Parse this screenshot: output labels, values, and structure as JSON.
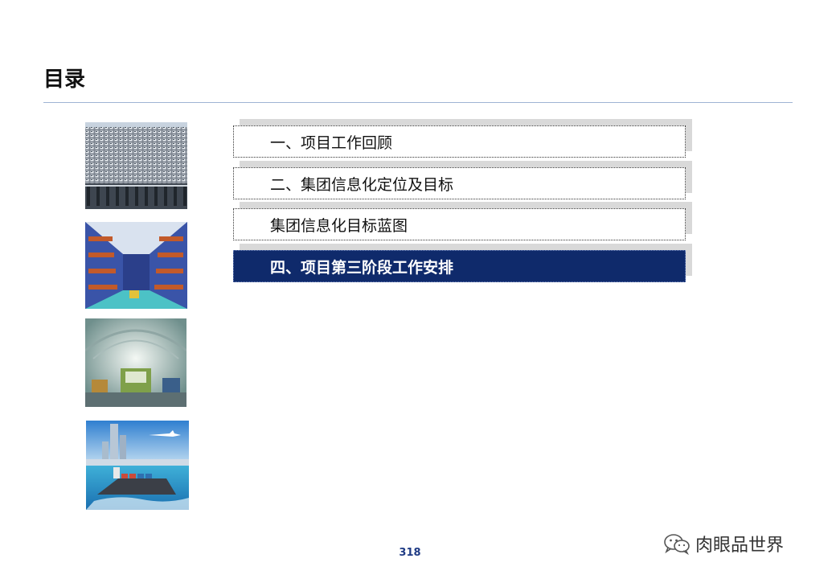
{
  "slide": {
    "title": "目录",
    "page_number": "318"
  },
  "menu": {
    "items": [
      {
        "label": "一、项目工作回顾",
        "active": false
      },
      {
        "label": "二、集团信息化定位及目标",
        "active": false
      },
      {
        "label": "集团信息化目标蓝图",
        "active": false
      },
      {
        "label": "四、项目第三阶段工作安排",
        "active": true
      }
    ]
  },
  "thumbnails": [
    {
      "subject": "car-parking-lot-photo"
    },
    {
      "subject": "warehouse-shelves-photo"
    },
    {
      "subject": "factory-hall-photo"
    },
    {
      "subject": "port-ship-airplane-photo"
    }
  ],
  "watermark": {
    "text": "肉眼品世界",
    "icon": "wechat-icon"
  },
  "colors": {
    "active_bg": "#0f2a6b",
    "rule": "#9fb3d4",
    "page_number": "#1f3b85",
    "shadow": "#d9d9d9"
  }
}
